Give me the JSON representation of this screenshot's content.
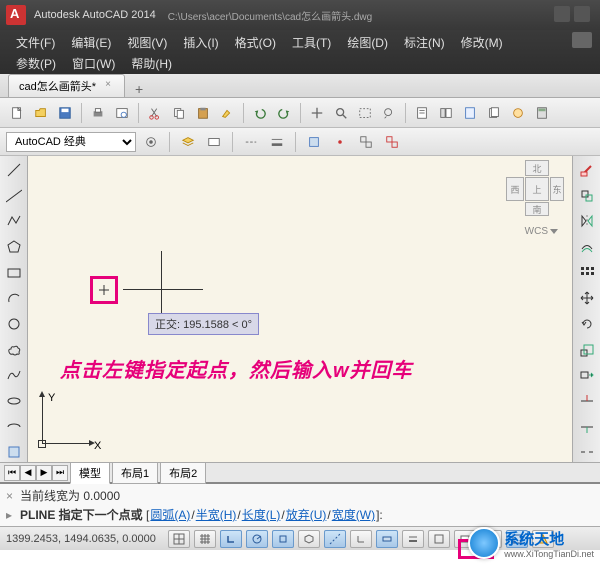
{
  "title": {
    "app": "Autodesk AutoCAD 2014",
    "path": "C:\\Users\\acer\\Documents\\cad怎么画箭头.dwg"
  },
  "menus": [
    "文件(F)",
    "编辑(E)",
    "视图(V)",
    "插入(I)",
    "格式(O)",
    "工具(T)",
    "绘图(D)",
    "标注(N)",
    "修改(M)",
    "参数(P)",
    "窗口(W)",
    "帮助(H)"
  ],
  "file_tab": {
    "label": "cad怎么画箭头*"
  },
  "workspace": {
    "selected": "AutoCAD 经典"
  },
  "viewcube": {
    "top": "上",
    "west": "西",
    "east": "东",
    "north": "北",
    "south": "南"
  },
  "wcs": {
    "label": "WCS"
  },
  "ortho_tooltip": "正交: 195.1588 < 0°",
  "instruction_text": "点击左键指定起点，然后输入w并回车",
  "ucs": {
    "x": "X",
    "y": "Y"
  },
  "layout_tabs": {
    "model": "模型",
    "layout1": "布局1",
    "layout2": "布局2"
  },
  "command": {
    "line1": "当前线宽为  0.0000",
    "prompt_head": "PLINE 指定下一个点或",
    "opts": [
      "圆弧(A)",
      "半宽(H)",
      "长度(L)",
      "放弃(U)",
      "宽度(W)"
    ],
    "bracket_open": " [",
    "bracket_close": "]: ",
    "sep": "/"
  },
  "status": {
    "coords": "1399.2453, 1494.0635, 0.0000"
  },
  "watermark": {
    "cn": "系统天地",
    "url": "www.XiTongTianDi.net"
  }
}
